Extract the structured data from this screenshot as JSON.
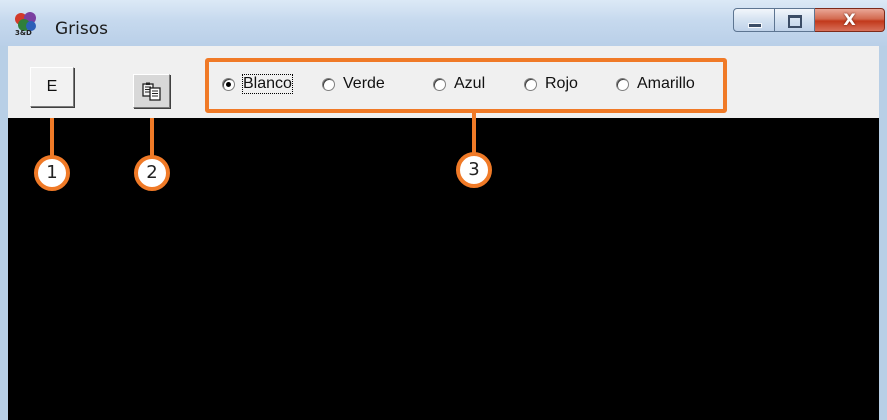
{
  "window": {
    "title": "Grisos",
    "icon": "grisos-app-icon",
    "controls": {
      "minimize": "minimize-icon",
      "maximize": "maximize-icon",
      "close": "close-icon",
      "close_glyph": "X"
    }
  },
  "toolbar": {
    "e_button_label": "E",
    "copy_button_icon": "copy-icon"
  },
  "color_options": {
    "selected": "Blanco",
    "items": [
      {
        "label": "Blanco",
        "selected": true
      },
      {
        "label": "Verde",
        "selected": false
      },
      {
        "label": "Azul",
        "selected": false
      },
      {
        "label": "Rojo",
        "selected": false
      },
      {
        "label": "Amarillo",
        "selected": false
      }
    ]
  },
  "annotations": {
    "markers": [
      "1",
      "2",
      "3"
    ],
    "color": "#f07a27"
  },
  "colors": {
    "canvas": "#000000",
    "titlebar": "#c6d9ee",
    "toolbar": "#f0f0f0"
  }
}
